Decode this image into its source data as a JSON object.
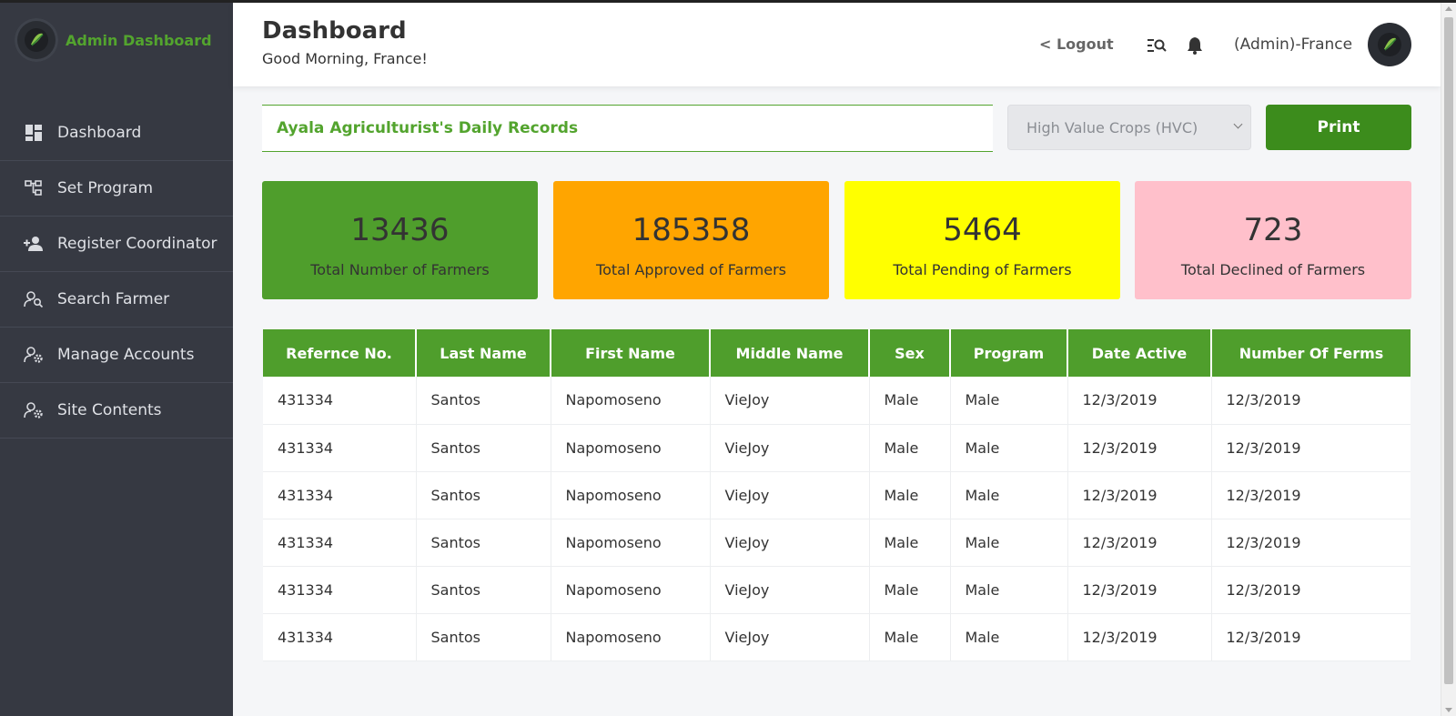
{
  "sidebar": {
    "brand_title": "Admin Dashboard",
    "items": [
      {
        "label": "Dashboard",
        "icon": "dashboard-icon"
      },
      {
        "label": "Set Program",
        "icon": "program-tree-icon"
      },
      {
        "label": "Register Coordinator",
        "icon": "add-user-icon"
      },
      {
        "label": "Search Farmer",
        "icon": "search-user-icon"
      },
      {
        "label": "Manage Accounts",
        "icon": "user-gear-icon"
      },
      {
        "label": "Site Contents",
        "icon": "user-gear-icon"
      }
    ]
  },
  "header": {
    "title": "Dashboard",
    "greeting": "Good Morning, France!",
    "logout_label": "< Logout",
    "user_name": "(Admin)-France"
  },
  "toolbar": {
    "records_title": "Ayala Agriculturist's Daily Records",
    "program_selected": "High Value Crops (HVC)",
    "print_label": "Print"
  },
  "stats": [
    {
      "value": "13436",
      "label": "Total Number of Farmers",
      "color": "#4f9e2c"
    },
    {
      "value": "185358",
      "label": "Total Approved of Farmers",
      "color": "#ffa500"
    },
    {
      "value": "5464",
      "label": "Total Pending of Farmers",
      "color": "#ffff00"
    },
    {
      "value": "723",
      "label": "Total Declined of Farmers",
      "color": "#ffc0cb"
    }
  ],
  "table": {
    "columns": [
      "Refernce No.",
      "Last Name",
      "First Name",
      "Middle Name",
      "Sex",
      "Program",
      "Date Active",
      "Number Of Ferms"
    ],
    "rows": [
      [
        "431334",
        "Santos",
        "Napomoseno",
        "VieJoy",
        "Male",
        "Male",
        "12/3/2019",
        "12/3/2019"
      ],
      [
        "431334",
        "Santos",
        "Napomoseno",
        "VieJoy",
        "Male",
        "Male",
        "12/3/2019",
        "12/3/2019"
      ],
      [
        "431334",
        "Santos",
        "Napomoseno",
        "VieJoy",
        "Male",
        "Male",
        "12/3/2019",
        "12/3/2019"
      ],
      [
        "431334",
        "Santos",
        "Napomoseno",
        "VieJoy",
        "Male",
        "Male",
        "12/3/2019",
        "12/3/2019"
      ],
      [
        "431334",
        "Santos",
        "Napomoseno",
        "VieJoy",
        "Male",
        "Male",
        "12/3/2019",
        "12/3/2019"
      ],
      [
        "431334",
        "Santos",
        "Napomoseno",
        "VieJoy",
        "Male",
        "Male",
        "12/3/2019",
        "12/3/2019"
      ]
    ]
  },
  "colors": {
    "accent_green": "#53a42e",
    "sidebar_bg": "#363942",
    "print_button": "#3c8c1c"
  }
}
